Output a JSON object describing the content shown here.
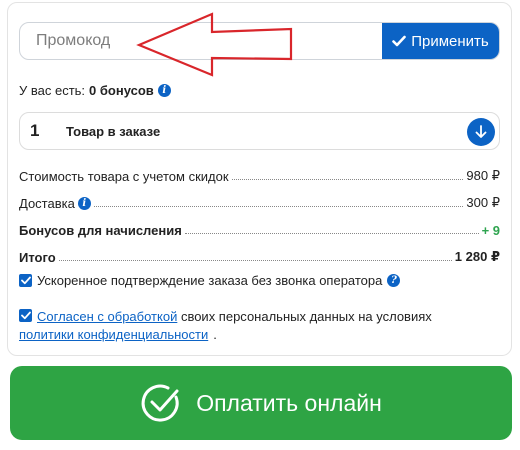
{
  "promo": {
    "placeholder": "Промокод",
    "apply_label": "Применить"
  },
  "bonus": {
    "prefix": "У вас есть:",
    "value": "0 бонусов"
  },
  "order": {
    "count": "1",
    "title": "Товар в заказе"
  },
  "summary": {
    "price_label": "Стоимость товара с учетом скидок",
    "price_value": "980 ₽",
    "delivery_label": "Доставка",
    "delivery_value": "300 ₽",
    "bonus_label": "Бонусов для начисления",
    "bonus_value": "+ 9",
    "total_label": "Итого",
    "total_value": "1 280 ₽"
  },
  "options": {
    "fast_confirm": "Ускоренное подтверждение заказа без звонка оператора",
    "consent_link": "Согласен с обработкой",
    "consent_text": " своих персональных данных на условиях ",
    "policy_link": "политики конфиденциальности",
    "consent_end": "."
  },
  "pay": {
    "label": "Оплатить онлайн"
  },
  "colors": {
    "accent": "#0c63c5",
    "success": "#2ea444",
    "annotation_arrow": "#d9262b"
  }
}
